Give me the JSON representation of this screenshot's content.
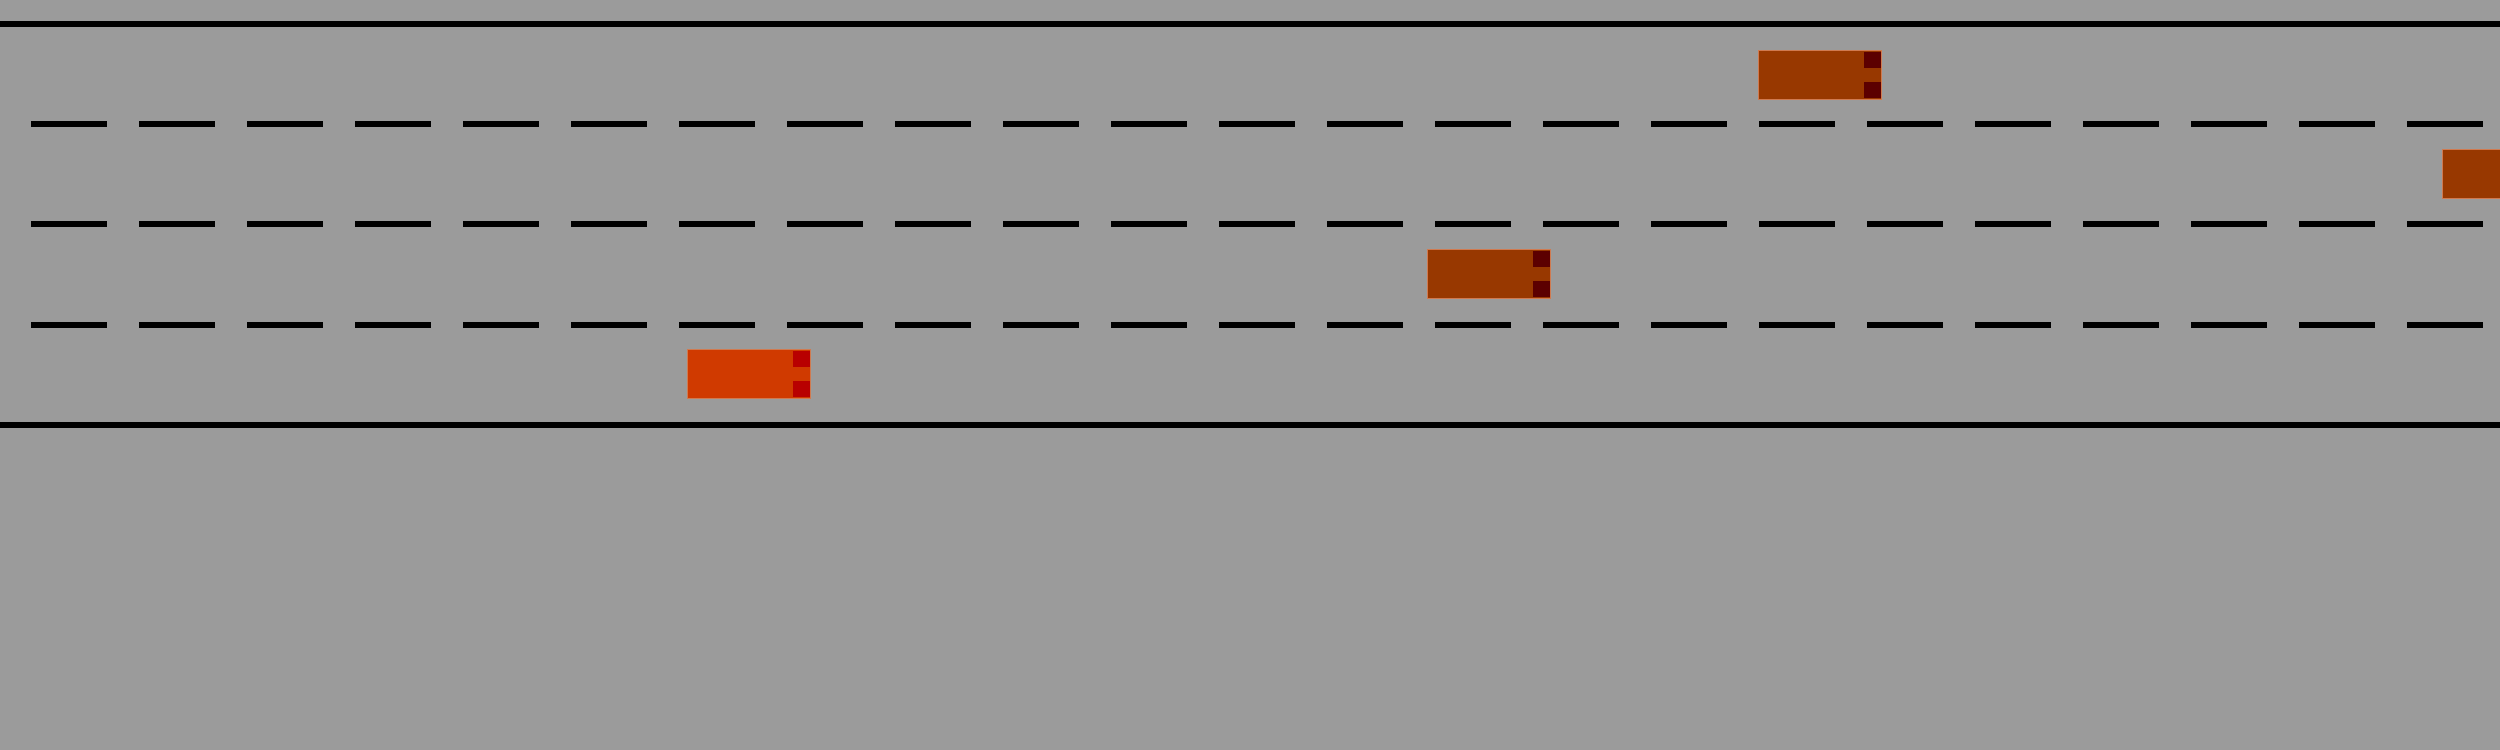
{
  "road": {
    "lane_count": 4,
    "background_color": "#9b9b9b",
    "line_color": "#000000"
  },
  "cars": [
    {
      "id": "ego",
      "lane": 4,
      "role": "ego",
      "body_color": "#d03a00",
      "light_color": "#b80000"
    },
    {
      "id": "car-1",
      "lane": 1,
      "role": "other",
      "body_color": "#983800",
      "light_color": "#5c0000"
    },
    {
      "id": "car-2",
      "lane": 2,
      "role": "other",
      "body_color": "#983800",
      "light_color": "#5c0000"
    },
    {
      "id": "car-3",
      "lane": 3,
      "role": "other",
      "body_color": "#983800",
      "light_color": "#5c0000"
    }
  ]
}
